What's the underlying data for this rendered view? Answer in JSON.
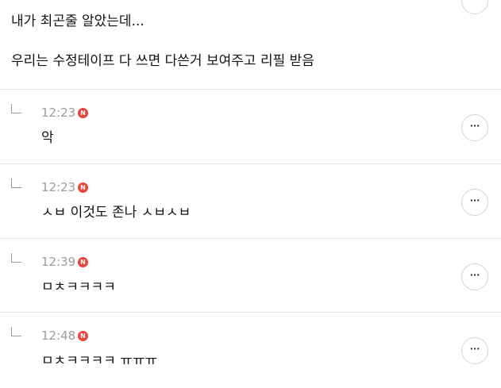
{
  "top_comment": {
    "line1": "내가 최곤줄 알았는데...",
    "line2": "우리는 수정테이프 다 쓰면 다쓴거 보여주고 리필 받음"
  },
  "more_label": "···",
  "replies": [
    {
      "time": "12:23",
      "badge": "N",
      "text": "악"
    },
    {
      "time": "12:23",
      "badge": "N",
      "text": "ㅅㅂ 이것도 존나 ㅅㅂㅅㅂ"
    },
    {
      "time": "12:39",
      "badge": "N",
      "text": "ㅁㅊㅋㅋㅋㅋ"
    },
    {
      "time": "12:48",
      "badge": "N",
      "text": "ㅁㅊㅋㅋㅋㅋ ㅠㅠㅠ"
    }
  ]
}
